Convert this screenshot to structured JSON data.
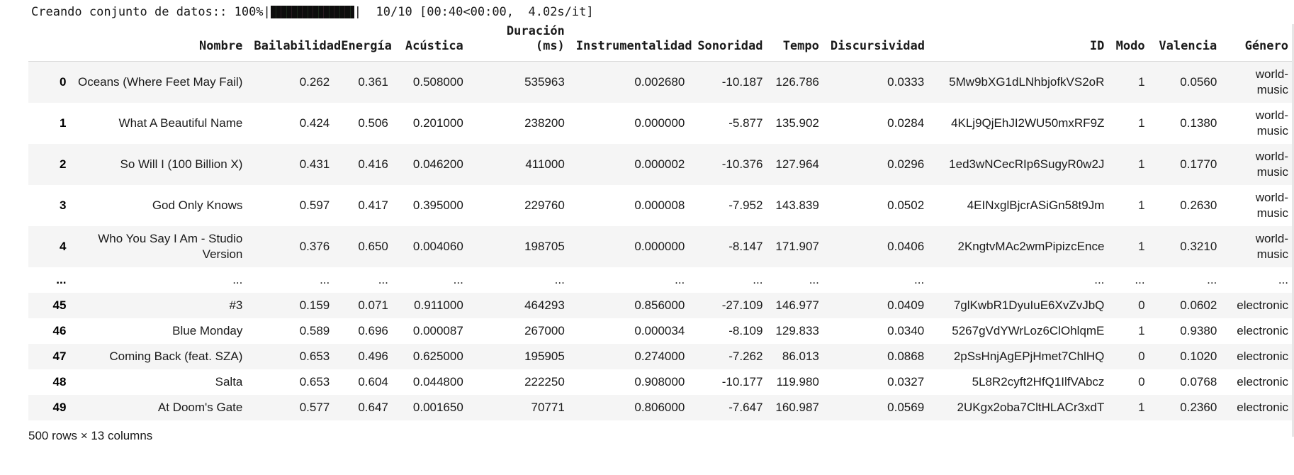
{
  "progress": {
    "description": "Creando conjunto de datos::",
    "percent": "100%",
    "left_pipe": "|",
    "right_pipe": "|",
    "counter": "10/10",
    "timing": "[00:40<00:00,  4.02s/it]",
    "bar_color": "#111111",
    "value": 100
  },
  "table": {
    "columns": [
      "Nombre",
      "Bailabilidad",
      "Energía",
      "Acústica",
      "Duración (ms)",
      "Instrumentalidad",
      "Sonoridad",
      "Tempo",
      "Discursividad",
      "ID",
      "Modo",
      "Valencia",
      "Género"
    ],
    "column_lines": [
      [
        "Nombre"
      ],
      [
        "Bailabilidad"
      ],
      [
        "Energía"
      ],
      [
        "Acústica"
      ],
      [
        "Duración",
        "(ms)"
      ],
      [
        "Instrumentalidad"
      ],
      [
        "Sonoridad"
      ],
      [
        "Tempo"
      ],
      [
        "Discursividad"
      ],
      [
        "ID"
      ],
      [
        "Modo"
      ],
      [
        "Valencia"
      ],
      [
        "Género"
      ]
    ],
    "index_header": "",
    "rows": [
      {
        "index": "0",
        "nombre": "Oceans (Where Feet May Fail)",
        "bailabilidad": "0.262",
        "energia": "0.361",
        "acustica": "0.508000",
        "duracion": "535963",
        "instrumentalidad": "0.002680",
        "sonoridad": "-10.187",
        "tempo": "126.786",
        "discursividad": "0.0333",
        "id": "5Mw9bXG1dLNhbjofkVS2oR",
        "modo": "1",
        "valencia": "0.0560",
        "genero": "world-music"
      },
      {
        "index": "1",
        "nombre": "What A Beautiful Name",
        "bailabilidad": "0.424",
        "energia": "0.506",
        "acustica": "0.201000",
        "duracion": "238200",
        "instrumentalidad": "0.000000",
        "sonoridad": "-5.877",
        "tempo": "135.902",
        "discursividad": "0.0284",
        "id": "4KLj9QjEhJI2WU50mxRF9Z",
        "modo": "1",
        "valencia": "0.1380",
        "genero": "world-music"
      },
      {
        "index": "2",
        "nombre": "So Will I (100 Billion X)",
        "bailabilidad": "0.431",
        "energia": "0.416",
        "acustica": "0.046200",
        "duracion": "411000",
        "instrumentalidad": "0.000002",
        "sonoridad": "-10.376",
        "tempo": "127.964",
        "discursividad": "0.0296",
        "id": "1ed3wNCecRIp6SugyR0w2J",
        "modo": "1",
        "valencia": "0.1770",
        "genero": "world-music"
      },
      {
        "index": "3",
        "nombre": "God Only Knows",
        "bailabilidad": "0.597",
        "energia": "0.417",
        "acustica": "0.395000",
        "duracion": "229760",
        "instrumentalidad": "0.000008",
        "sonoridad": "-7.952",
        "tempo": "143.839",
        "discursividad": "0.0502",
        "id": "4EINxglBjcrASiGn58t9Jm",
        "modo": "1",
        "valencia": "0.2630",
        "genero": "world-music"
      },
      {
        "index": "4",
        "nombre": "Who You Say I Am - Studio Version",
        "bailabilidad": "0.376",
        "energia": "0.650",
        "acustica": "0.004060",
        "duracion": "198705",
        "instrumentalidad": "0.000000",
        "sonoridad": "-8.147",
        "tempo": "171.907",
        "discursividad": "0.0406",
        "id": "2KngtvMAc2wmPipizcEnce",
        "modo": "1",
        "valencia": "0.3210",
        "genero": "world-music"
      },
      {
        "index": "...",
        "nombre": "...",
        "bailabilidad": "...",
        "energia": "...",
        "acustica": "...",
        "duracion": "...",
        "instrumentalidad": "...",
        "sonoridad": "...",
        "tempo": "...",
        "discursividad": "...",
        "id": "...",
        "modo": "...",
        "valencia": "...",
        "genero": "..."
      },
      {
        "index": "45",
        "nombre": "#3",
        "bailabilidad": "0.159",
        "energia": "0.071",
        "acustica": "0.911000",
        "duracion": "464293",
        "instrumentalidad": "0.856000",
        "sonoridad": "-27.109",
        "tempo": "146.977",
        "discursividad": "0.0409",
        "id": "7glKwbR1DyuIuE6XvZvJbQ",
        "modo": "0",
        "valencia": "0.0602",
        "genero": "electronic"
      },
      {
        "index": "46",
        "nombre": "Blue Monday",
        "bailabilidad": "0.589",
        "energia": "0.696",
        "acustica": "0.000087",
        "duracion": "267000",
        "instrumentalidad": "0.000034",
        "sonoridad": "-8.109",
        "tempo": "129.833",
        "discursividad": "0.0340",
        "id": "5267gVdYWrLoz6ClOhlqmE",
        "modo": "1",
        "valencia": "0.9380",
        "genero": "electronic"
      },
      {
        "index": "47",
        "nombre": "Coming Back (feat. SZA)",
        "bailabilidad": "0.653",
        "energia": "0.496",
        "acustica": "0.625000",
        "duracion": "195905",
        "instrumentalidad": "0.274000",
        "sonoridad": "-7.262",
        "tempo": "86.013",
        "discursividad": "0.0868",
        "id": "2pSsHnjAgEPjHmet7ChlHQ",
        "modo": "0",
        "valencia": "0.1020",
        "genero": "electronic"
      },
      {
        "index": "48",
        "nombre": "Salta",
        "bailabilidad": "0.653",
        "energia": "0.604",
        "acustica": "0.044800",
        "duracion": "222250",
        "instrumentalidad": "0.908000",
        "sonoridad": "-10.177",
        "tempo": "119.980",
        "discursividad": "0.0327",
        "id": "5L8R2cyft2HfQ1IlfVAbcz",
        "modo": "0",
        "valencia": "0.0768",
        "genero": "electronic"
      },
      {
        "index": "49",
        "nombre": "At Doom's Gate",
        "bailabilidad": "0.577",
        "energia": "0.647",
        "acustica": "0.001650",
        "duracion": "70771",
        "instrumentalidad": "0.806000",
        "sonoridad": "-7.647",
        "tempo": "160.987",
        "discursividad": "0.0569",
        "id": "2UKgx2oba7CltHLACr3xdT",
        "modo": "1",
        "valencia": "0.2360",
        "genero": "electronic"
      }
    ],
    "footer": "500 rows × 13 columns"
  }
}
